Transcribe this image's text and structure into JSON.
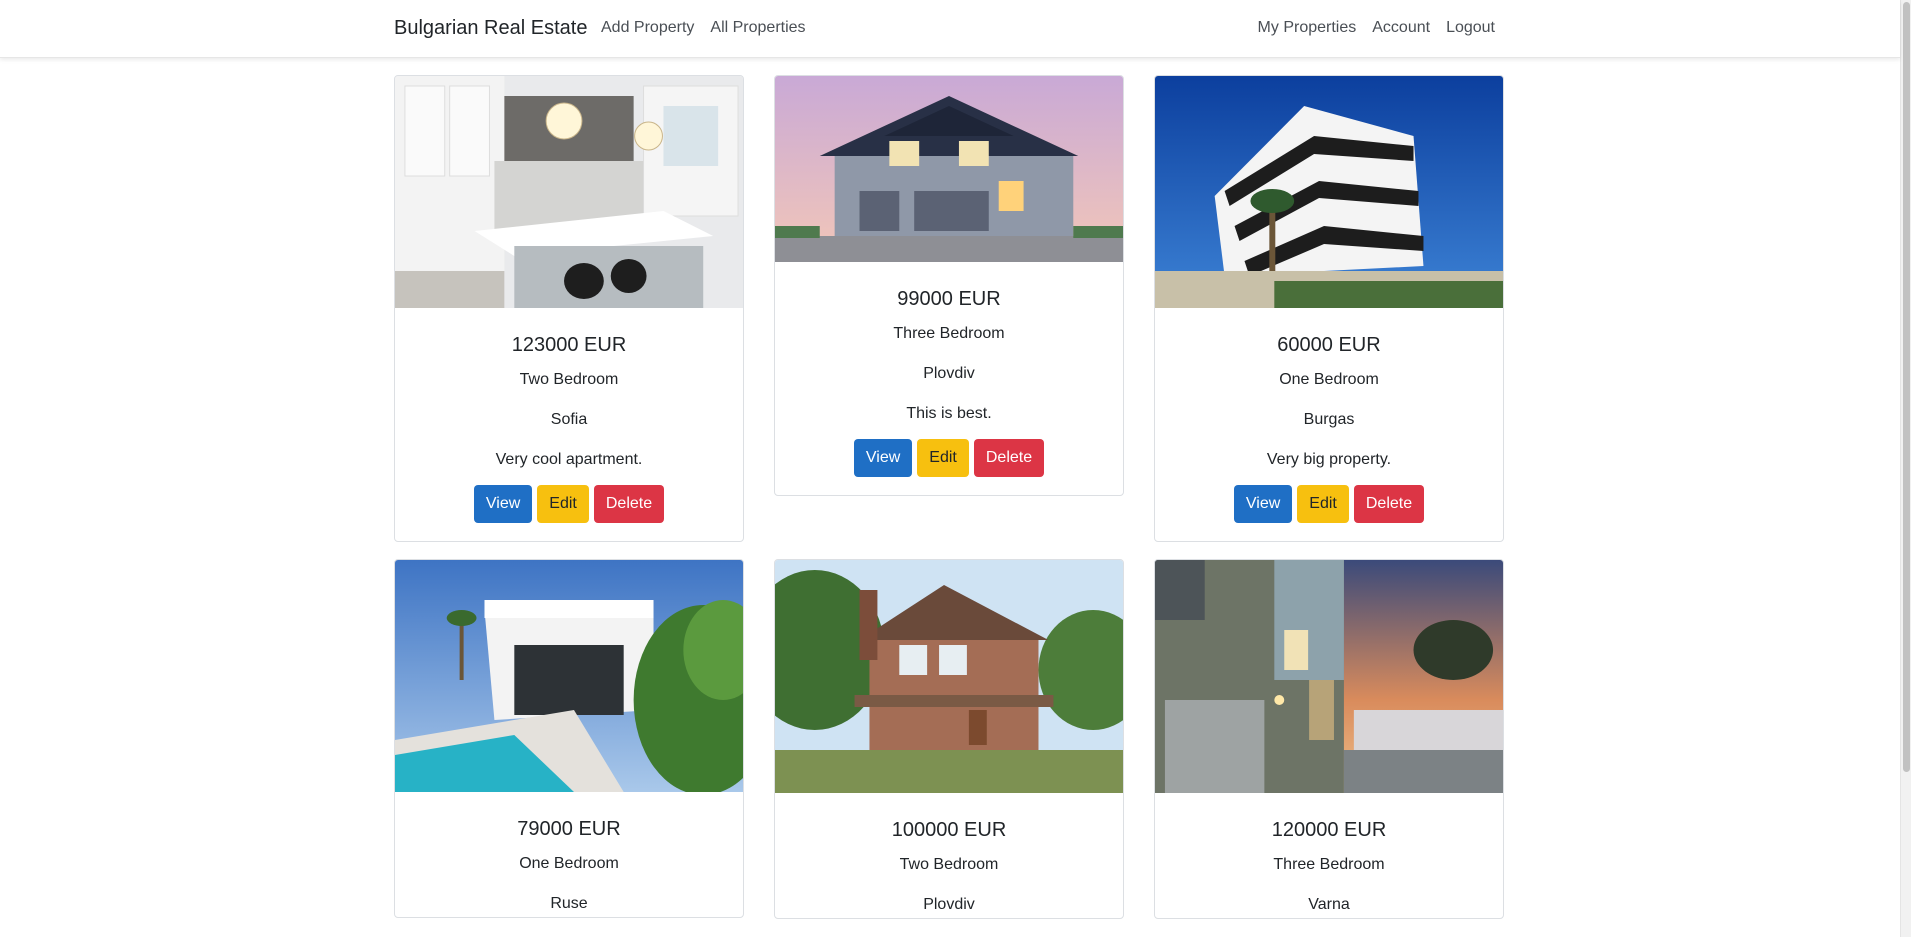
{
  "navbar": {
    "brand": "Bulgarian Real Estate",
    "left_links": [
      "Add Property",
      "All Properties"
    ],
    "right_links": [
      "My Properties",
      "Account",
      "Logout"
    ]
  },
  "buttons": {
    "view": "View",
    "edit": "Edit",
    "delete": "Delete"
  },
  "properties": [
    {
      "price": "123000 EUR",
      "type": "Two Bedroom",
      "city": "Sofia",
      "description": "Very cool apartment.",
      "image": "kitchen-interior"
    },
    {
      "price": "99000 EUR",
      "type": "Three Bedroom",
      "city": "Plovdiv",
      "description": "This is best.",
      "image": "house-dusk"
    },
    {
      "price": "60000 EUR",
      "type": "One Bedroom",
      "city": "Burgas",
      "description": "Very big property.",
      "image": "white-apartment-building"
    },
    {
      "price": "79000 EUR",
      "type": "One Bedroom",
      "city": "Ruse",
      "description": "",
      "image": "pool-villa"
    },
    {
      "price": "100000 EUR",
      "type": "Two Bedroom",
      "city": "Plovdiv",
      "description": "",
      "image": "craftsman-house"
    },
    {
      "price": "120000 EUR",
      "type": "Three Bedroom",
      "city": "Varna",
      "description": "",
      "image": "modern-house-night"
    }
  ]
}
